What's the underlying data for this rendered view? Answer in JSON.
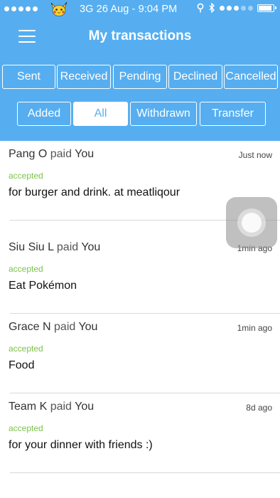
{
  "status_bar": {
    "carrier_icon": "pikachu-icon",
    "network_time": "3G 26 Aug - 9:04 PM",
    "icons": [
      "location-icon",
      "bluetooth-icon",
      "signal-dots-icon",
      "battery-icon"
    ]
  },
  "nav": {
    "menu_icon": "hamburger-icon",
    "title": "My transactions"
  },
  "filters_row1": [
    "Sent",
    "Received",
    "Pending",
    "Declined",
    "Cancelled"
  ],
  "filters_row2": [
    "Added",
    "All",
    "Withdrawn",
    "Transfer"
  ],
  "selected_filter": "All",
  "colors": {
    "header": "#56aef0",
    "accepted": "#7ec24a",
    "white": "#ffffff"
  },
  "transactions": [
    {
      "payer": "Pang O",
      "verb": "paid",
      "payee": "You",
      "time": "Just now",
      "status": "accepted",
      "description": "for burger and drink. at meatliqour"
    },
    {
      "payer": "Siu Siu L",
      "verb": "paid",
      "payee": "You",
      "time": "1min ago",
      "status": "accepted",
      "description": "Eat Pokémon"
    },
    {
      "payer": "Grace N",
      "verb": "paid",
      "payee": "You",
      "time": "1min ago",
      "status": "accepted",
      "description": "Food"
    },
    {
      "payer": "Team K",
      "verb": "paid",
      "payee": "You",
      "time": "8d ago",
      "status": "accepted",
      "description": "for your dinner with friends :)"
    }
  ],
  "assistive_touch_icon": "assistive-touch-icon"
}
